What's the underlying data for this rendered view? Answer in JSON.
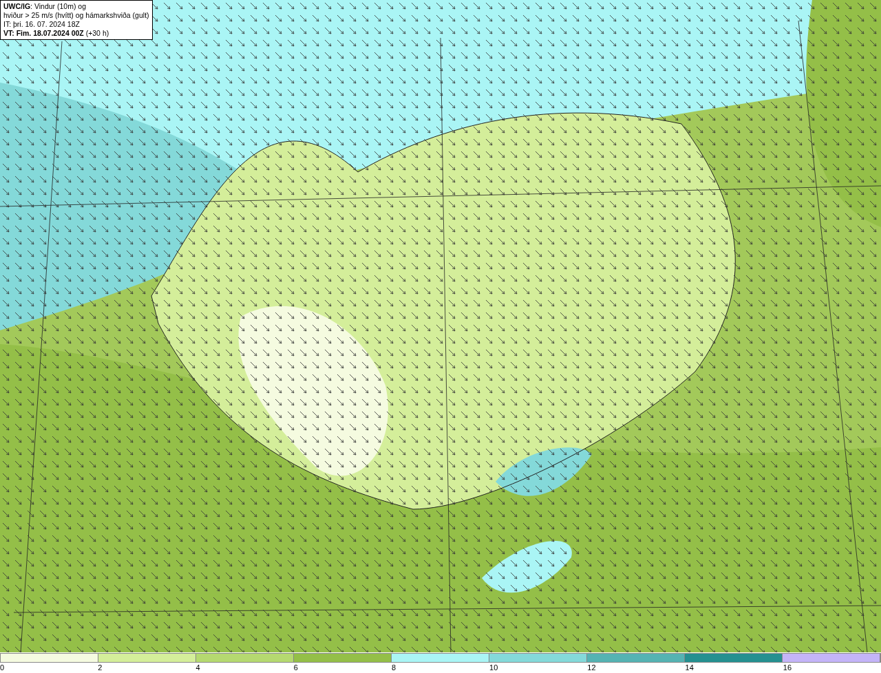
{
  "info_box": {
    "lines": [
      "**UWC/IG**: Vindur (10m) og",
      "hviður > 25 m/s (hvítt) og hámarkshviða (gult)",
      "IT: þri. 16. 07. 2024 18Z",
      "**VT: Fim. 18.07.2024 00Z** (+30 h)"
    ]
  },
  "legend": {
    "bins": [
      {
        "color": "#f5fbe0"
      },
      {
        "color": "#d4ee9a"
      },
      {
        "color": "#b5d970"
      },
      {
        "color": "#94bf48"
      },
      {
        "color": "#aaf5f5"
      },
      {
        "color": "#84d9d9"
      },
      {
        "color": "#55b3b3"
      },
      {
        "color": "#259090"
      },
      {
        "color": "#c4b4f8"
      }
    ],
    "ticks": [
      "0",
      "2",
      "4",
      "6",
      "8",
      "10",
      "12",
      "14",
      "16"
    ]
  }
}
